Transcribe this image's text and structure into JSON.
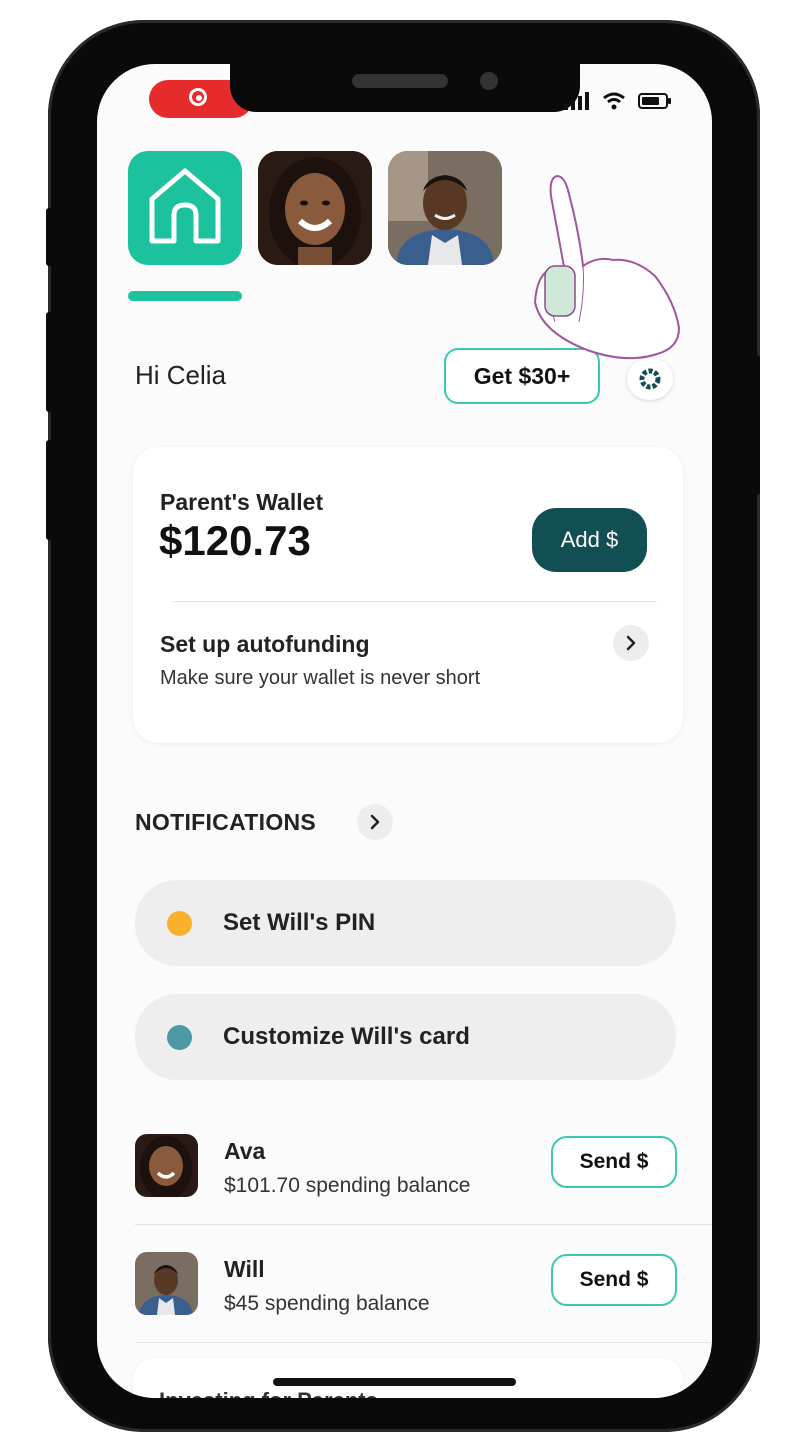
{
  "header": {
    "tabs": [
      {
        "name": "home",
        "icon": "house-icon"
      },
      {
        "name": "Ava",
        "icon": "avatar"
      },
      {
        "name": "Will",
        "icon": "avatar"
      }
    ],
    "greeting": "Hi Celia",
    "promo_button": "Get $30+",
    "settings_icon": "gear-icon"
  },
  "wallet": {
    "title": "Parent's Wallet",
    "amount": "$120.73",
    "add_button": "Add $",
    "autofunding_title": "Set up autofunding",
    "autofunding_subtitle": "Make sure your wallet is never short"
  },
  "notifications": {
    "header": "NOTIFICATIONS",
    "items": [
      {
        "label": "Set Will's PIN",
        "dot_color": "#f9b02a"
      },
      {
        "label": "Customize Will's card",
        "dot_color": "#4b9aa3"
      }
    ]
  },
  "children": [
    {
      "name": "Ava",
      "balance": "$101.70 spending balance",
      "button": "Send $"
    },
    {
      "name": "Will",
      "balance": "$45 spending balance",
      "button": "Send $"
    }
  ],
  "bottom_card": {
    "text": "Investing for Parents"
  },
  "colors": {
    "accent": "#1bc29d",
    "primary_button": "#124f55",
    "outline": "#3cc8b0",
    "recording": "#e52b2b"
  }
}
